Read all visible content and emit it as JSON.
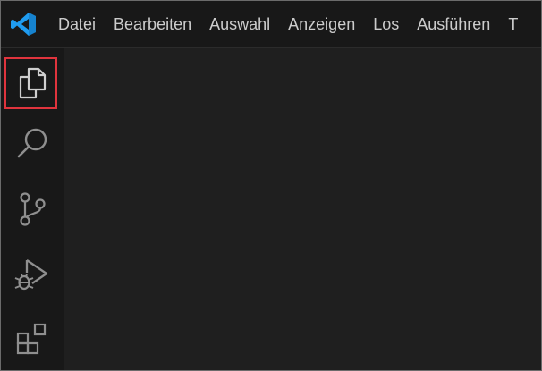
{
  "window": {
    "app_icon": "vscode-logo-icon",
    "brand_color": "#1f9cf0"
  },
  "menu": {
    "items": [
      {
        "label": "Datei"
      },
      {
        "label": "Bearbeiten"
      },
      {
        "label": "Auswahl"
      },
      {
        "label": "Anzeigen"
      },
      {
        "label": "Los"
      },
      {
        "label": "Ausführen"
      },
      {
        "label": "T"
      }
    ]
  },
  "activity_bar": {
    "items": [
      {
        "icon": "explorer-files-icon",
        "highlighted": true,
        "highlight_color": "#e0343d"
      },
      {
        "icon": "search-icon"
      },
      {
        "icon": "source-control-icon"
      },
      {
        "icon": "run-and-debug-icon"
      },
      {
        "icon": "extensions-icon"
      }
    ]
  }
}
